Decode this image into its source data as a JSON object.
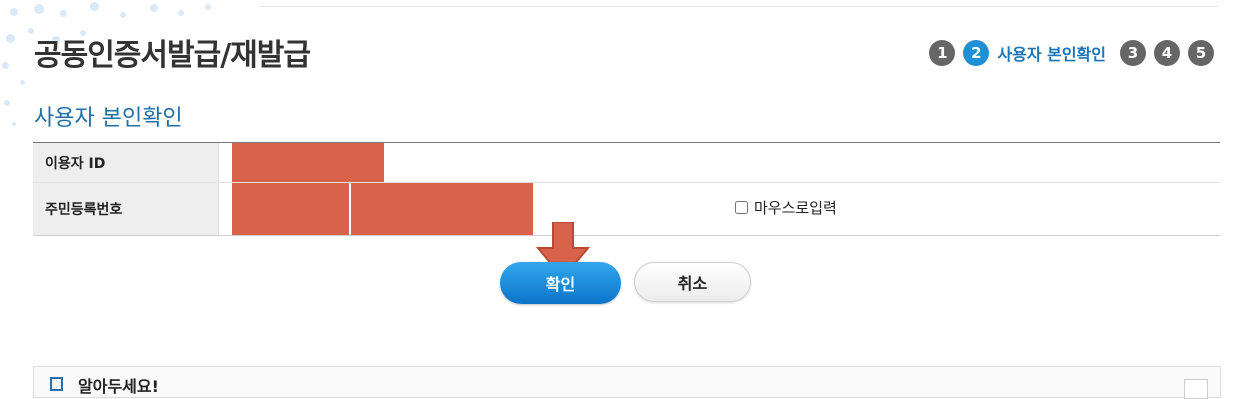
{
  "header": {
    "page_title": "공동인증서발급/재발급",
    "steps": [
      {
        "number": "1",
        "active": false
      },
      {
        "number": "2",
        "active": true,
        "label": "사용자 본인확인"
      },
      {
        "number": "3",
        "active": false
      },
      {
        "number": "4",
        "active": false
      },
      {
        "number": "5",
        "active": false
      }
    ]
  },
  "form": {
    "section_title": "사용자 본인확인",
    "rows": [
      {
        "label": "이용자 ID",
        "value": ""
      },
      {
        "label": "주민등록번호",
        "value": ""
      }
    ],
    "mouse_input_label": "마우스로입력",
    "mouse_input_checked": false
  },
  "actions": {
    "confirm_label": "확인",
    "cancel_label": "취소"
  },
  "notice": {
    "title": "알아두세요!"
  },
  "colors": {
    "accent": "#1f8fd6",
    "step_inactive": "#666666",
    "redaction": "#d9624a",
    "section_title": "#1f6fa8"
  }
}
